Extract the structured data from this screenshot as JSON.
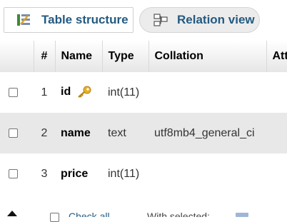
{
  "tabs": [
    {
      "label": "Table structure",
      "icon": "table-structure-icon",
      "active": true
    },
    {
      "label": "Relation view",
      "icon": "relation-view-icon",
      "active": false
    }
  ],
  "table": {
    "headers": [
      "#",
      "Name",
      "Type",
      "Collation",
      "Attributes"
    ],
    "rows": [
      {
        "num": "1",
        "name": "id",
        "type": "int(11)",
        "collation": "",
        "primary_key": true
      },
      {
        "num": "2",
        "name": "name",
        "type": "text",
        "collation": "utf8mb4_general_ci",
        "primary_key": false
      },
      {
        "num": "3",
        "name": "price",
        "type": "int(11)",
        "collation": "",
        "primary_key": false
      }
    ]
  },
  "footer": {
    "check_all_label": "Check all",
    "with_selected_label": "With selected:"
  },
  "colors": {
    "accent": "#235a81",
    "row_alt": "#e8e8e8",
    "key": "#e6b12e"
  }
}
